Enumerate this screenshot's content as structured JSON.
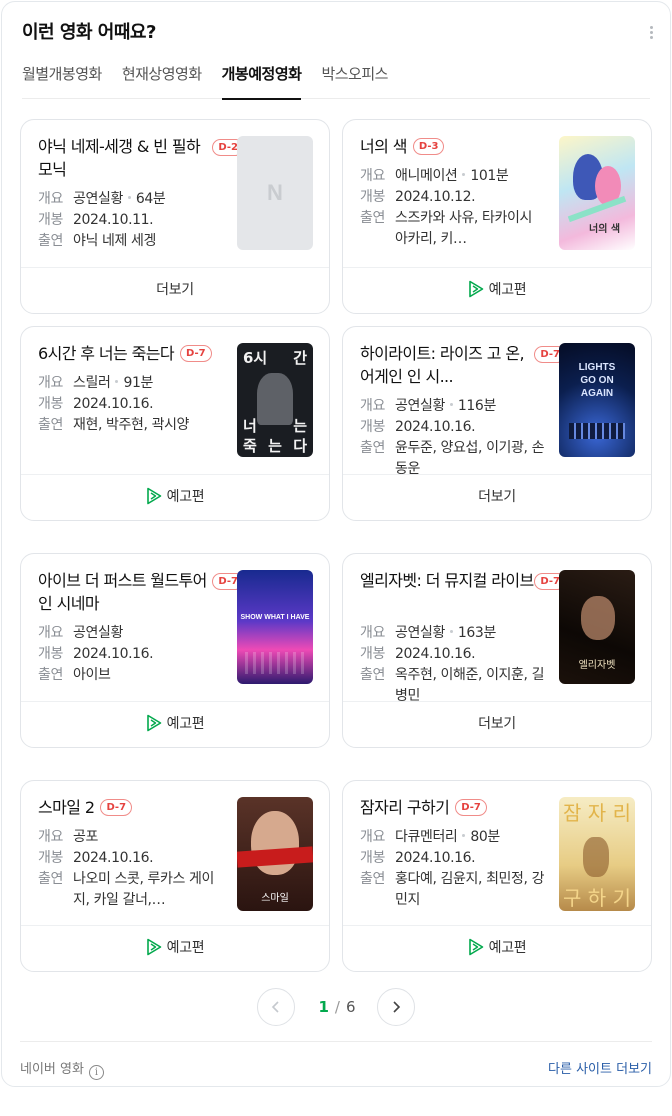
{
  "header": {
    "title": "이런 영화 어때요?",
    "more_icon": "more-vertical-icon"
  },
  "tabs": [
    {
      "label": "월별개봉영화",
      "active": false
    },
    {
      "label": "현재상영영화",
      "active": false
    },
    {
      "label": "개봉예정영화",
      "active": true
    },
    {
      "label": "박스오피스",
      "active": false
    }
  ],
  "labels": {
    "genre": "개요",
    "release": "개봉",
    "cast": "출연"
  },
  "movies": [
    {
      "title": "야닉 네제-세갱 & 빈 필하모닉",
      "dday": "D-2",
      "genre": "공연실황",
      "runtime": "64분",
      "release": "2024.10.11.",
      "cast": "야닉 네제 세겡",
      "button": "더보기",
      "poster": "placeholder"
    },
    {
      "title": "너의 색",
      "dday": "D-3",
      "genre": "애니메이션",
      "runtime": "101분",
      "release": "2024.10.12.",
      "cast": "스즈카와 사유, 타카이시 아카리, 키…",
      "button": "예고편",
      "poster": "anime"
    },
    {
      "title": "6시간 후 너는 죽는다",
      "dday": "D-7",
      "genre": "스릴러",
      "runtime": "91분",
      "release": "2024.10.16.",
      "cast": "재현, 박주현, 곽시양",
      "button": "예고편",
      "poster": "thriller"
    },
    {
      "title": "하이라이트: 라이즈 고 온, 어게인 인 시...",
      "dday": "D-7",
      "genre": "공연실황",
      "runtime": "116분",
      "release": "2024.10.16.",
      "cast": "윤두준, 양요섭, 이기광, 손동운",
      "button": "더보기",
      "poster": "concert-blue"
    },
    {
      "title": "아이브 더 퍼스트 월드투어 인 시네마",
      "dday": "D-7",
      "genre": "공연실황",
      "runtime": "",
      "release": "2024.10.16.",
      "cast": "아이브",
      "button": "예고편",
      "poster": "concert-ive"
    },
    {
      "title": "엘리자벳: 더 뮤지컬 라이브",
      "dday": "D-7",
      "genre": "공연실황",
      "runtime": "163분",
      "release": "2024.10.16.",
      "cast": "옥주현, 이해준, 이지훈, 길병민",
      "button": "더보기",
      "poster": "musical"
    },
    {
      "title": "스마일 2",
      "dday": "D-7",
      "genre": "공포",
      "runtime": "",
      "release": "2024.10.16.",
      "cast": "나오미 스콧, 루카스 게이지, 카일 갈너,…",
      "button": "예고편",
      "poster": "horror"
    },
    {
      "title": "잠자리 구하기",
      "dday": "D-7",
      "genre": "다큐멘터리",
      "runtime": "80분",
      "release": "2024.10.16.",
      "cast": "홍다예, 김윤지, 최민정, 강민지",
      "button": "예고편",
      "poster": "doc"
    }
  ],
  "poster_texts": {
    "placeholder": "N",
    "anime_title": "너의 색",
    "thriller": [
      "6시",
      "간",
      "너",
      "는",
      "죽",
      "는",
      "다"
    ],
    "concert_blue": [
      "LIGHTS",
      "GO ON",
      "AGAIN"
    ],
    "concert_ive": "SHOW WHAT I HAVE",
    "musical": "엘리자벳",
    "horror": "스마일",
    "doc": [
      "잠",
      "자",
      "리",
      "구",
      "하",
      "기"
    ]
  },
  "pagination": {
    "current": "1",
    "separator": "/",
    "total": "6"
  },
  "footer": {
    "source": "네이버 영화",
    "other_sites": "다른 사이트 더보기"
  },
  "colors": {
    "accent_green": "#03a94d",
    "dday_red": "#e5423f",
    "link_blue": "#2a5ea8"
  }
}
